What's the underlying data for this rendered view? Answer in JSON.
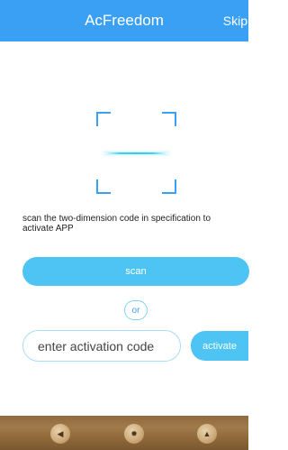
{
  "header": {
    "title": "AcFreedom",
    "skip_label": "Skip"
  },
  "scanner": {
    "corner_color": "#3aa0f3",
    "line_color": "#46d2ec"
  },
  "instruction": "scan the two-dimension code in specification to activate APP",
  "scan_button": "scan",
  "separator": "or",
  "activation": {
    "placeholder": "enter activation code",
    "button_label": "activate"
  },
  "nav": {
    "back_icon": "◀",
    "home_icon": "✹",
    "up_icon": "▲"
  },
  "colors": {
    "accent": "#3aa0f3",
    "button": "#4dc4f3"
  }
}
